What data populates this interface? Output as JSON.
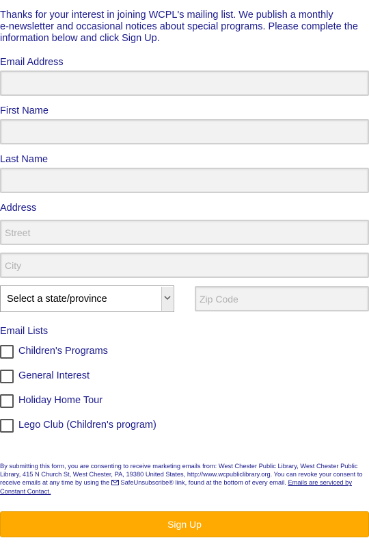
{
  "intro": {
    "line1": "Thanks for your interest in joining WCPL's mailing list. We publish a monthly",
    "line2": "e-newsletter and occasional notices about special programs. Please complete the",
    "line3": "information below and click Sign Up."
  },
  "fields": {
    "email_label": "Email Address",
    "email_value": "",
    "first_name_label": "First Name",
    "first_name_value": "",
    "last_name_label": "Last Name",
    "last_name_value": "",
    "address_label": "Address",
    "street_placeholder": "Street",
    "city_placeholder": "City",
    "state_selected": "Select a state/province",
    "zip_placeholder": "Zip Code"
  },
  "email_lists": {
    "label": "Email Lists",
    "items": [
      {
        "label": "Children's Programs",
        "checked": false
      },
      {
        "label": "General Interest",
        "checked": false
      },
      {
        "label": "Holiday Home Tour",
        "checked": false
      },
      {
        "label": "Lego Club (Children's program)",
        "checked": false
      }
    ]
  },
  "disclaimer": {
    "text_before": "By submitting this form, you are consenting to receive marketing emails from: West Chester Public Library, West Chester Public Library, 415 N Church St, West Chester, PA, 19380 United States, http://www.wcpubliclibrary.org. You can revoke your consent to receive emails at any time by using the",
    "safeunsubscribe": "SafeUnsubscribe® link, found at the bottom of every email.",
    "link_text": "Emails are serviced by Constant Contact."
  },
  "signup_button": "Sign Up",
  "colors": {
    "text": "#1a1a8c",
    "button": "#ffaa00",
    "field_bg": "#f2f2f2"
  }
}
